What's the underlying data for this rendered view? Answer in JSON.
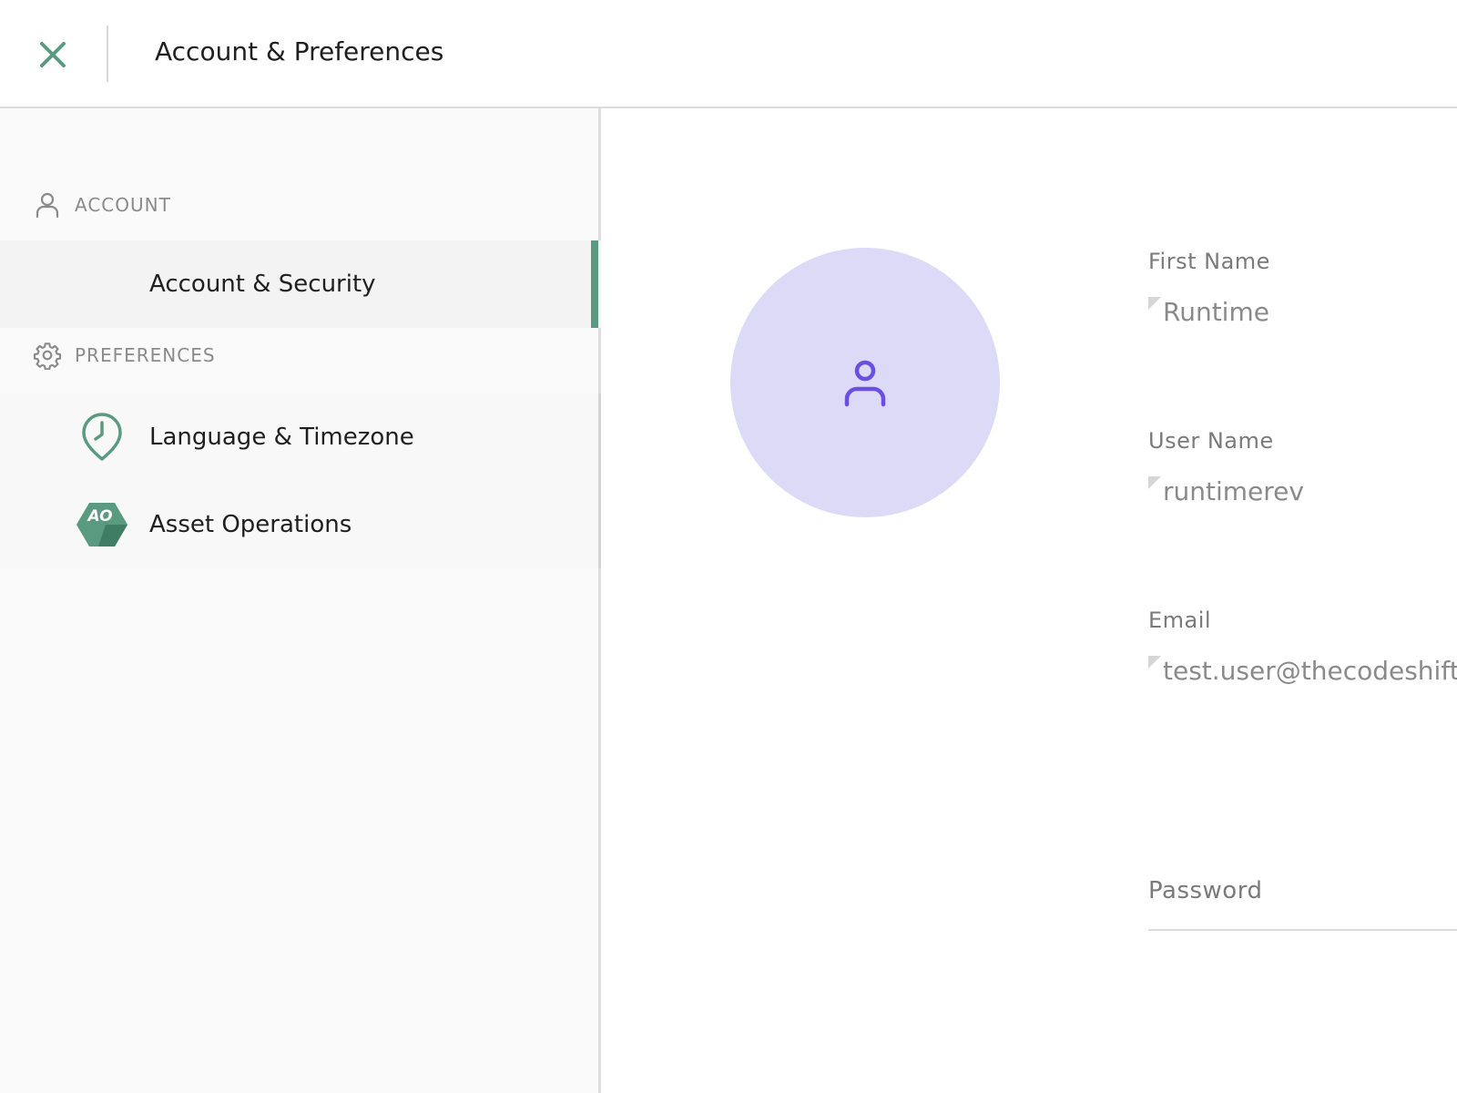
{
  "header": {
    "title": "Account & Preferences"
  },
  "sidebar": {
    "account_section": {
      "label": "ACCOUNT"
    },
    "account_items": [
      {
        "label": "Account & Security",
        "active": true
      }
    ],
    "preferences_section": {
      "label": "PREFERENCES"
    },
    "preference_items": [
      {
        "label": "Language & Timezone"
      },
      {
        "label": "Asset Operations",
        "icon_text": "AO"
      }
    ]
  },
  "profile": {
    "first_name": {
      "label": "First Name",
      "value": "Runtime"
    },
    "user_name": {
      "label": "User Name",
      "value": "runtimerev"
    },
    "email": {
      "label": "Email",
      "value": "test.user@thecodeshift."
    },
    "password": {
      "label": "Password"
    }
  },
  "colors": {
    "accent": "#5a9a80",
    "avatar_bg": "#dcdaf7",
    "avatar_icon": "#6a4fe0"
  }
}
